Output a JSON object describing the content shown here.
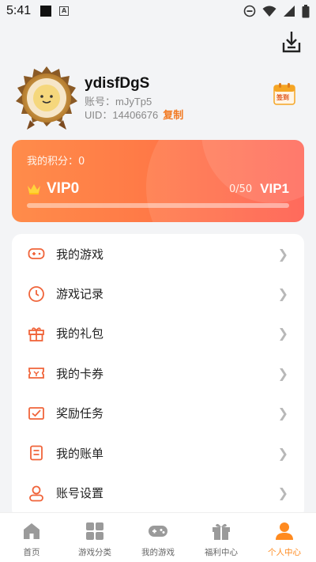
{
  "status_bar": {
    "time": "5:41"
  },
  "profile": {
    "username": "ydisfDgS",
    "account_line": "账号：mJyTp5",
    "uid_line": "UID：14406676",
    "copy_label": "复制",
    "signin_label": "签到"
  },
  "vip": {
    "points_line": "我的积分：0",
    "current_level": "VIP0",
    "progress_text": "0/50",
    "next_level": "VIP1",
    "progress_fraction": 0
  },
  "menu": {
    "items": [
      {
        "label": "我的游戏",
        "icon": "gamepad-icon"
      },
      {
        "label": "游戏记录",
        "icon": "clock-icon"
      },
      {
        "label": "我的礼包",
        "icon": "gift-icon"
      },
      {
        "label": "我的卡券",
        "icon": "ticket-icon"
      },
      {
        "label": "奖励任务",
        "icon": "task-icon"
      },
      {
        "label": "我的账单",
        "icon": "bill-icon"
      },
      {
        "label": "账号设置",
        "icon": "user-settings-icon"
      }
    ]
  },
  "bottom_nav": {
    "items": [
      {
        "label": "首页",
        "icon": "home-icon"
      },
      {
        "label": "游戏分类",
        "icon": "grid-icon"
      },
      {
        "label": "我的游戏",
        "icon": "gamepad-icon"
      },
      {
        "label": "福利中心",
        "icon": "gift-icon"
      },
      {
        "label": "个人中心",
        "icon": "person-icon"
      }
    ],
    "active": "个人中心"
  },
  "colors": {
    "accent": "#ff8a1f",
    "vip_gradient_start": "#ff8c4a",
    "vip_gradient_end": "#ff5a4a",
    "icon": "#f0643a"
  }
}
